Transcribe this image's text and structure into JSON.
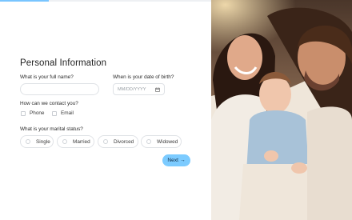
{
  "progress": {
    "value": 0.23,
    "color": "#79c5ff"
  },
  "form": {
    "title": "Personal Information",
    "full_name": {
      "label": "What is your full name?",
      "value": "",
      "placeholder": ""
    },
    "dob": {
      "label": "When is your date of birth?",
      "placeholder": "MM/DD/YYYY",
      "icon": "calendar-icon"
    },
    "contact": {
      "label": "How can we contact you?",
      "options": [
        "Phone",
        "Email"
      ]
    },
    "marital": {
      "label": "What is your marital status?",
      "options": [
        "Single",
        "Married",
        "Divorced",
        "Widowed"
      ]
    },
    "next_label": "Next",
    "next_icon": "arrow-right-icon"
  },
  "colors": {
    "accent": "#7ccbff",
    "border": "#dfe2e6"
  }
}
